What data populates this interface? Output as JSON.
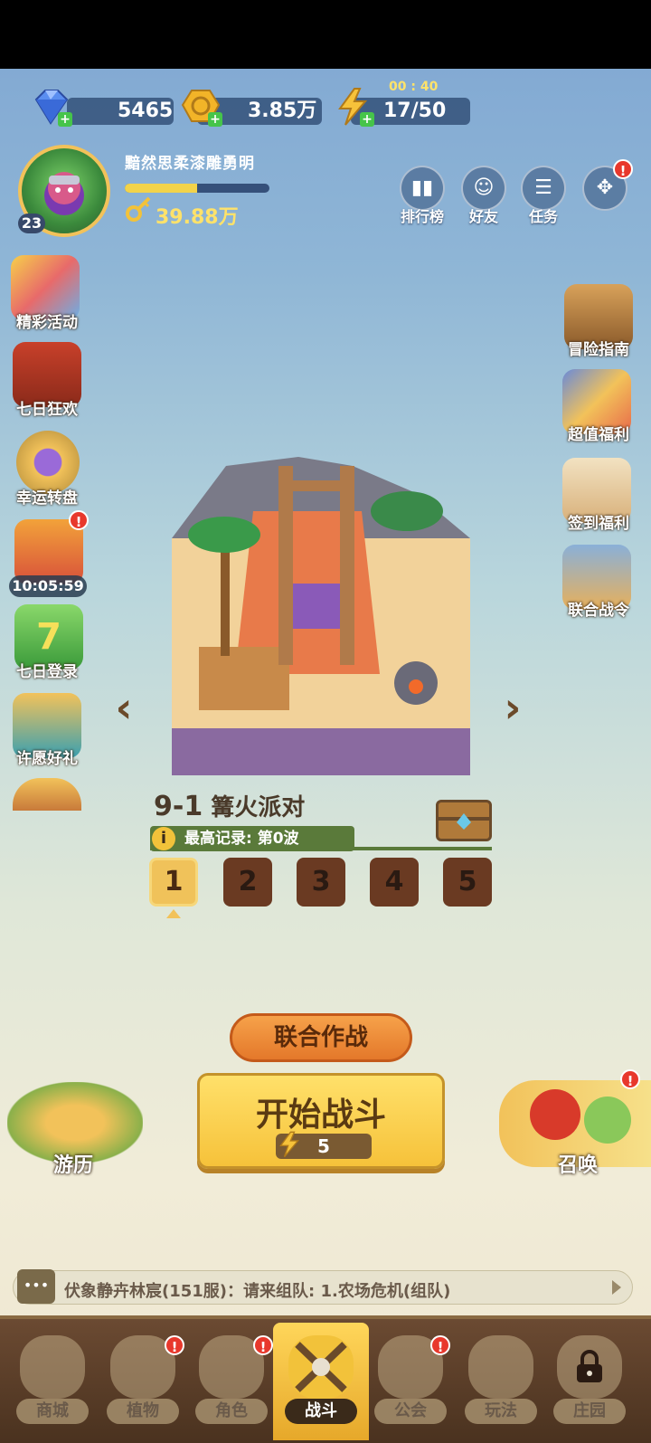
{
  "resources": {
    "gems": "5465",
    "gold": "3.85万",
    "energy": "17/50",
    "energy_timer": "00 : 40"
  },
  "player": {
    "name": "黯然思柔漆雕勇明",
    "level": "23",
    "power": "39.88万",
    "xp_progress": 0.5
  },
  "top_menu": [
    {
      "label": "排行榜",
      "icon": "leaderboard-icon"
    },
    {
      "label": "好友",
      "icon": "friends-icon"
    },
    {
      "label": "任务",
      "icon": "tasks-icon"
    },
    {
      "label": "",
      "icon": "gamepad-icon",
      "badge": "!"
    }
  ],
  "left_menu": [
    {
      "label": "精彩活动",
      "icon": "events-icon"
    },
    {
      "label": "七日狂欢",
      "icon": "carnival-icon"
    },
    {
      "label": "幸运转盘",
      "icon": "lucky-wheel-icon"
    },
    {
      "label": "10:05:59",
      "icon": "gift-box-icon",
      "badge": "!"
    },
    {
      "label": "七日登录",
      "icon": "seven-day-login-icon"
    },
    {
      "label": "许愿好礼",
      "icon": "wish-gift-icon"
    }
  ],
  "right_menu": [
    {
      "label": "冒险指南",
      "icon": "adventure-guide-icon"
    },
    {
      "label": "超值福利",
      "icon": "value-welfare-icon"
    },
    {
      "label": "签到福利",
      "icon": "sign-in-icon"
    },
    {
      "label": "联合战令",
      "icon": "battle-pass-icon"
    }
  ],
  "stage": {
    "number": "9-1",
    "name": "篝火派对",
    "record": "最高记录: 第0波",
    "waves": [
      "1",
      "2",
      "3",
      "4",
      "5"
    ],
    "selected_wave": "1"
  },
  "buttons": {
    "coop": "联合作战",
    "start": "开始战斗",
    "start_cost": "5",
    "travel": "游历",
    "summon": "召唤"
  },
  "chat": {
    "message": "伏象静卉林宸(151服)：请来组队: 1.农场危机(组队)"
  },
  "nav": [
    {
      "label": "商城",
      "icon": "shop-icon"
    },
    {
      "label": "植物",
      "icon": "plants-icon",
      "badge": "!"
    },
    {
      "label": "角色",
      "icon": "character-icon",
      "badge": "!"
    },
    {
      "label": "战斗",
      "icon": "battle-icon",
      "active": true
    },
    {
      "label": "公会",
      "icon": "guild-icon",
      "badge": "!"
    },
    {
      "label": "玩法",
      "icon": "gameplay-icon"
    },
    {
      "label": "庄园",
      "icon": "manor-lock-icon"
    }
  ],
  "colors": {
    "accent_gold": "#f6c23a",
    "badge_red": "#e8382c",
    "nav_brown": "#4a321f"
  }
}
